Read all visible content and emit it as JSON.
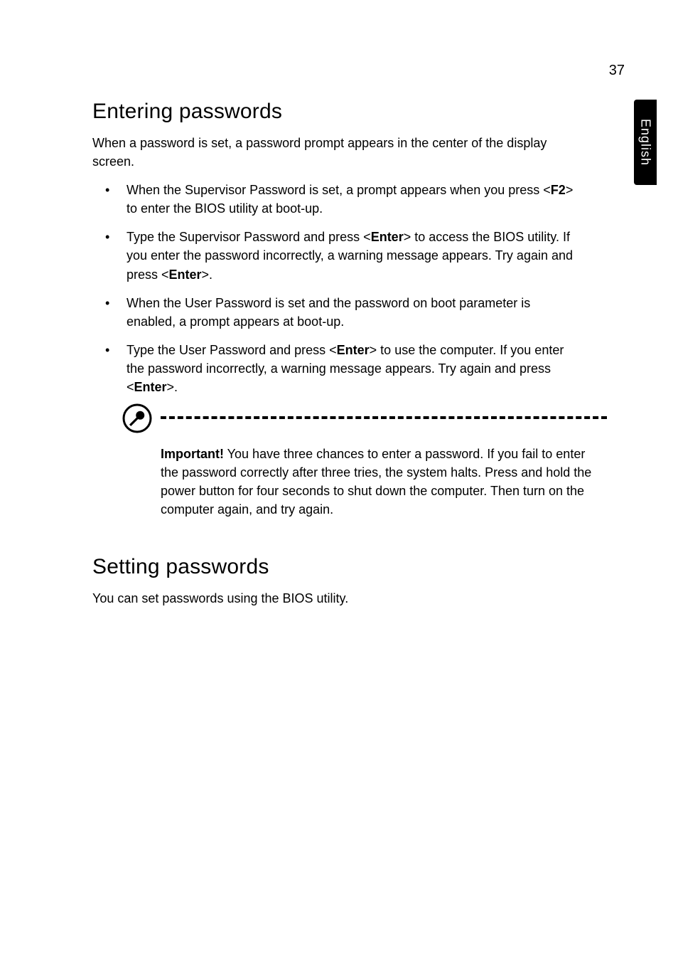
{
  "page_number": "37",
  "side_tab": "English",
  "sections": {
    "entering": {
      "heading": "Entering passwords",
      "intro": "When a password is set, a password prompt appears in the center of the display screen.",
      "bullets": [
        {
          "pre": "When the Supervisor Password is set, a prompt appears when you press <",
          "key": "F2",
          "post": "> to enter the BIOS utility at boot-up."
        },
        {
          "pre": "Type the Supervisor Password and press <",
          "key": "Enter",
          "post_a": "> to access the BIOS utility. If you enter the password incorrectly, a warning message appears. Try again and press <",
          "key_b": "Enter",
          "post_b": ">."
        },
        {
          "text": "When the User Password is set and the password on boot parameter is enabled, a prompt appears at boot-up."
        },
        {
          "pre": "Type the User Password and press <",
          "key": "Enter",
          "post_a": "> to use the computer. If you enter the password incorrectly, a warning message appears. Try again and press <",
          "key_b": "Enter",
          "post_b": ">."
        }
      ],
      "callout": {
        "label": "Important!",
        "text": " You have three chances to enter a password. If you fail to enter the password correctly after three tries, the system halts. Press and hold the power button for four seconds to shut down the computer. Then turn on the computer again, and try again."
      }
    },
    "setting": {
      "heading": "Setting passwords",
      "intro": "You can set passwords using the BIOS utility."
    }
  }
}
